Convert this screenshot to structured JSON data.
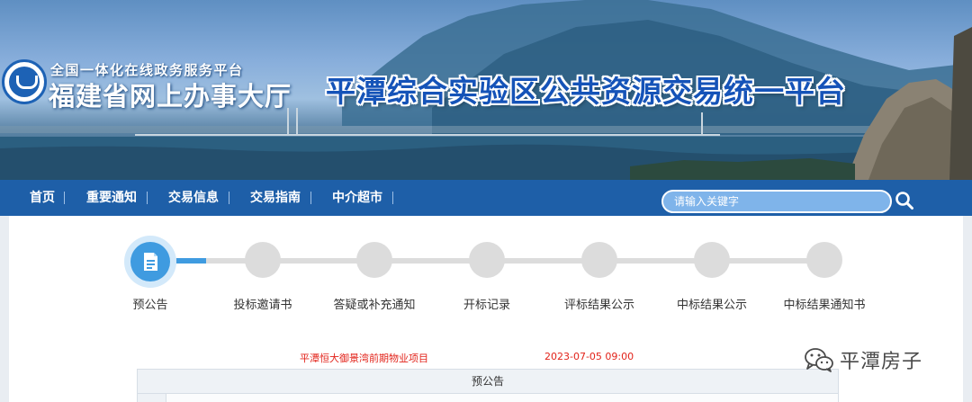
{
  "header": {
    "gov_subtitle": "全国一体化在线政务服务平台",
    "gov_title": "福建省网上办事大厅",
    "platform_title": "平潭综合实验区公共资源交易统一平台"
  },
  "nav": {
    "items": [
      {
        "label": "首页"
      },
      {
        "label": "重要通知"
      },
      {
        "label": "交易信息"
      },
      {
        "label": "交易指南"
      },
      {
        "label": "中介超市"
      }
    ],
    "search_placeholder": "请输入关键字"
  },
  "steps": {
    "items": [
      {
        "label": "预公告",
        "active": true
      },
      {
        "label": "投标邀请书",
        "active": false
      },
      {
        "label": "答疑或补充通知",
        "active": false
      },
      {
        "label": "开标记录",
        "active": false
      },
      {
        "label": "评标结果公示",
        "active": false
      },
      {
        "label": "中标结果公示",
        "active": false
      },
      {
        "label": "中标结果通知书",
        "active": false
      }
    ],
    "progress_fraction": 0.27
  },
  "project": {
    "name": "平潭恒大御景湾前期物业项目",
    "date": "2023-07-05 09:00"
  },
  "table": {
    "header": "预公告"
  },
  "watermark": {
    "text": "平潭房子",
    "icon": "wechat-icon"
  },
  "colors": {
    "nav_bg": "#1e5fa8",
    "accent": "#3f9be0",
    "title_blue": "#1553b8",
    "alert_red": "#e2231a"
  }
}
